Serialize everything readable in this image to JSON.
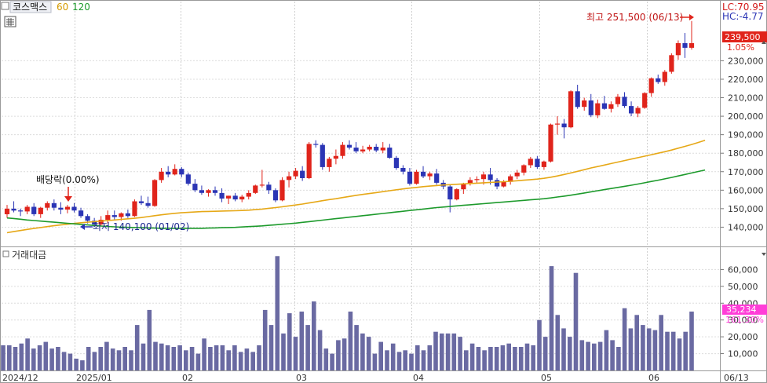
{
  "header": {
    "symbol": "코스맥스",
    "ma_periods": [
      "60",
      "120"
    ],
    "lc_label": "LC:70.95",
    "hc_label": "HC:-4.77"
  },
  "colors": {
    "up": "#e0241b",
    "down": "#2b35b5",
    "ma60": "#e6a817",
    "ma120": "#1d9a2c",
    "volume": "#6a6aa2",
    "price_tag": "#e0241b",
    "volume_tag": "#ff3dd8"
  },
  "price_panel": {
    "current_price": "239,500",
    "current_change": "1.05%",
    "high_annotation": "최고 251,500 (06/13)",
    "low_annotation": "최저 140,100 (01/02)",
    "dividend_annotation": "배당락(0.00%)"
  },
  "volume_panel": {
    "title": "거래대금",
    "current_value": "35,234",
    "current_change": "161.30%"
  },
  "x_axis_labels": [
    "2024/12",
    "2025/01",
    "02",
    "03",
    "04",
    "05",
    "06",
    "06/13"
  ],
  "chart_data": [
    {
      "type": "candlestick",
      "title": "",
      "ylim": [
        130000,
        262000
      ],
      "y_ticks": [
        140000,
        150000,
        160000,
        170000,
        180000,
        190000,
        200000,
        210000,
        220000,
        230000
      ],
      "y_tick_labels": [
        "140,000",
        "150,000",
        "160,000",
        "170,000",
        "180,000",
        "190,000",
        "200,000",
        "210,000",
        "220,000",
        "230,000"
      ],
      "ohlc": [
        [
          147000,
          152000,
          145000,
          150000
        ],
        [
          150000,
          154000,
          148000,
          149000
        ],
        [
          149000,
          150000,
          146000,
          148500
        ],
        [
          148500,
          152000,
          147000,
          151000
        ],
        [
          151000,
          153000,
          146000,
          147000
        ],
        [
          147000,
          151000,
          145000,
          150500
        ],
        [
          150500,
          154000,
          149000,
          153000
        ],
        [
          153000,
          155000,
          149000,
          150500
        ],
        [
          150500,
          153500,
          147000,
          149500
        ],
        [
          149500,
          152000,
          147500,
          151000
        ],
        [
          151000,
          153000,
          148000,
          149000
        ],
        [
          149000,
          150500,
          145000,
          146000
        ],
        [
          146000,
          147000,
          142000,
          143500
        ],
        [
          143500,
          145000,
          140100,
          141500
        ],
        [
          141500,
          146000,
          140800,
          144000
        ],
        [
          144000,
          149000,
          142000,
          146500
        ],
        [
          146500,
          149000,
          144000,
          145500
        ],
        [
          145500,
          148000,
          143500,
          147500
        ],
        [
          147500,
          149500,
          145000,
          146000
        ],
        [
          146000,
          155000,
          145500,
          154000
        ],
        [
          154000,
          157000,
          152000,
          153000
        ],
        [
          153000,
          156500,
          150500,
          151500
        ],
        [
          151500,
          166000,
          151000,
          165500
        ],
        [
          165500,
          172000,
          164000,
          170000
        ],
        [
          170000,
          173000,
          167000,
          168500
        ],
        [
          168500,
          174000,
          168000,
          171500
        ],
        [
          171500,
          172500,
          167000,
          168500
        ],
        [
          168500,
          169500,
          162500,
          163500
        ],
        [
          163500,
          166000,
          159000,
          160000
        ],
        [
          160000,
          162500,
          157500,
          158500
        ],
        [
          158500,
          160500,
          156500,
          160000
        ],
        [
          160000,
          162000,
          157000,
          158500
        ],
        [
          158500,
          161000,
          153500,
          155500
        ],
        [
          155500,
          157000,
          152500,
          157000
        ],
        [
          157000,
          158500,
          154000,
          155000
        ],
        [
          155000,
          157500,
          153500,
          156500
        ],
        [
          156500,
          160000,
          155000,
          158500
        ],
        [
          158500,
          163000,
          158000,
          162500
        ],
        [
          162500,
          171000,
          161500,
          163000
        ],
        [
          163000,
          164500,
          158000,
          160000
        ],
        [
          160000,
          161000,
          153500,
          154500
        ],
        [
          154500,
          167000,
          154000,
          165500
        ],
        [
          165500,
          170000,
          161500,
          167500
        ],
        [
          167500,
          172000,
          166000,
          170500
        ],
        [
          170500,
          173000,
          165000,
          166500
        ],
        [
          166500,
          186000,
          166000,
          185000
        ],
        [
          185000,
          187000,
          183000,
          184500
        ],
        [
          184500,
          185500,
          171000,
          172500
        ],
        [
          172500,
          178000,
          170000,
          177000
        ],
        [
          177000,
          182000,
          174000,
          178500
        ],
        [
          178500,
          186000,
          177000,
          184500
        ],
        [
          184500,
          187000,
          182000,
          183000
        ],
        [
          183000,
          186000,
          180000,
          181000
        ],
        [
          181000,
          184000,
          180000,
          182000
        ],
        [
          182000,
          184500,
          181000,
          183500
        ],
        [
          183500,
          185000,
          180500,
          181500
        ],
        [
          181500,
          186000,
          180000,
          183000
        ],
        [
          183000,
          185000,
          177000,
          177500
        ],
        [
          177500,
          178500,
          171000,
          172000
        ],
        [
          172000,
          173500,
          168500,
          170000
        ],
        [
          170000,
          172000,
          162500,
          163500
        ],
        [
          163500,
          171000,
          163000,
          170000
        ],
        [
          170000,
          173000,
          166500,
          167500
        ],
        [
          167500,
          170000,
          165500,
          169000
        ],
        [
          169000,
          171500,
          163000,
          164000
        ],
        [
          164000,
          165500,
          160500,
          162000
        ],
        [
          162000,
          163000,
          148000,
          155000
        ],
        [
          155000,
          161000,
          154500,
          160500
        ],
        [
          160500,
          164000,
          158000,
          163500
        ],
        [
          163500,
          167000,
          162500,
          165500
        ],
        [
          165500,
          167500,
          164000,
          166000
        ],
        [
          166000,
          170000,
          163000,
          168500
        ],
        [
          168500,
          172000,
          163000,
          165500
        ],
        [
          165500,
          166500,
          160500,
          162000
        ],
        [
          162000,
          165500,
          161500,
          164500
        ],
        [
          164500,
          168500,
          163000,
          167500
        ],
        [
          167500,
          171000,
          166000,
          169500
        ],
        [
          169500,
          174000,
          168000,
          173500
        ],
        [
          173500,
          178000,
          172000,
          177000
        ],
        [
          177000,
          178500,
          171500,
          172500
        ],
        [
          172500,
          176000,
          171000,
          175500
        ],
        [
          175500,
          196000,
          175000,
          195500
        ],
        [
          195500,
          200000,
          190000,
          196000
        ],
        [
          196000,
          198500,
          188000,
          194000
        ],
        [
          194000,
          214000,
          193500,
          213500
        ],
        [
          213500,
          217000,
          204000,
          205000
        ],
        [
          205000,
          210000,
          203000,
          208500
        ],
        [
          208500,
          212000,
          199500,
          200500
        ],
        [
          200500,
          209000,
          199000,
          207000
        ],
        [
          207000,
          211000,
          203500,
          204000
        ],
        [
          204000,
          208000,
          202000,
          206500
        ],
        [
          206500,
          212000,
          205000,
          210500
        ],
        [
          210500,
          213000,
          204500,
          205500
        ],
        [
          205500,
          208000,
          200000,
          201500
        ],
        [
          201500,
          205500,
          199500,
          204500
        ],
        [
          204500,
          213000,
          204000,
          212500
        ],
        [
          212500,
          221000,
          210500,
          220500
        ],
        [
          220500,
          222500,
          217500,
          218500
        ],
        [
          218500,
          225000,
          216500,
          224000
        ],
        [
          224000,
          234000,
          223000,
          233000
        ],
        [
          233000,
          241000,
          230500,
          239500
        ],
        [
          239500,
          245000,
          231500,
          237000
        ],
        [
          237000,
          251500,
          236000,
          239500
        ]
      ],
      "series": [
        {
          "name": "60",
          "values": [
            137000,
            137600,
            138200,
            138800,
            139300,
            139800,
            140300,
            140800,
            141200,
            141600,
            142000,
            142400,
            142700,
            143000,
            143300,
            143600,
            143900,
            144200,
            144500,
            144800,
            145200,
            145700,
            146200,
            146700,
            147100,
            147500,
            147800,
            148000,
            148200,
            148400,
            148500,
            148600,
            148700,
            148800,
            148900,
            149000,
            149200,
            149500,
            149800,
            150200,
            150600,
            151000,
            151500,
            152000,
            152500,
            153100,
            153700,
            154300,
            154900,
            155400,
            156000,
            156600,
            157200,
            157700,
            158200,
            158700,
            159200,
            159700,
            160200,
            160700,
            161100,
            161500,
            161900,
            162200,
            162500,
            162800,
            163000,
            163200,
            163400,
            163600,
            163800,
            164000,
            164200,
            164400,
            164600,
            164800,
            165100,
            165400,
            165700,
            166000,
            166400,
            167000,
            167700,
            168500,
            169300,
            170200,
            171100,
            172000,
            172800,
            173600,
            174400,
            175200,
            176000,
            176800,
            177600,
            178400,
            179200,
            180000,
            180800,
            181700,
            182700,
            183700,
            184700,
            185800,
            187000
          ]
        },
        {
          "name": "120",
          "values": [
            145000,
            144700,
            144300,
            143900,
            143600,
            143300,
            143000,
            142700,
            142400,
            142100,
            141800,
            141500,
            141200,
            140900,
            140600,
            140400,
            140200,
            140000,
            139900,
            139800,
            139700,
            139600,
            139500,
            139400,
            139400,
            139400,
            139400,
            139400,
            139400,
            139400,
            139500,
            139600,
            139700,
            139800,
            139900,
            140100,
            140300,
            140500,
            140700,
            141000,
            141300,
            141600,
            141900,
            142200,
            142600,
            143000,
            143400,
            143800,
            144200,
            144600,
            145000,
            145400,
            145800,
            146200,
            146600,
            147000,
            147400,
            147800,
            148200,
            148600,
            149000,
            149400,
            149800,
            150200,
            150600,
            150900,
            151200,
            151500,
            151800,
            152100,
            152400,
            152700,
            153000,
            153300,
            153600,
            153900,
            154200,
            154500,
            154800,
            155100,
            155400,
            155800,
            156300,
            156800,
            157300,
            157900,
            158500,
            159100,
            159700,
            160300,
            160900,
            161500,
            162100,
            162700,
            163300,
            164000,
            164700,
            165400,
            166100,
            166900,
            167700,
            168500,
            169300,
            170100,
            170900
          ]
        }
      ]
    },
    {
      "type": "bar",
      "title": "",
      "ylim": [
        0,
        70000
      ],
      "y_ticks": [
        10000,
        20000,
        30000,
        40000,
        50000,
        60000
      ],
      "y_tick_labels": [
        "10,000",
        "20,000",
        "30,000",
        "40,000",
        "50,000",
        "60,000"
      ],
      "values": [
        15000,
        15000,
        14000,
        16000,
        19000,
        13000,
        15000,
        17000,
        13000,
        14000,
        11000,
        10000,
        7000,
        6000,
        14000,
        11000,
        14000,
        17000,
        13000,
        12000,
        14000,
        12000,
        27000,
        16000,
        36000,
        17000,
        16000,
        15000,
        14000,
        15000,
        12000,
        14000,
        10000,
        19000,
        14000,
        15000,
        15000,
        12000,
        15000,
        11000,
        13000,
        11000,
        15000,
        36000,
        27000,
        68000,
        22000,
        34000,
        20000,
        35000,
        27000,
        41000,
        24000,
        13000,
        10000,
        18000,
        19000,
        35000,
        27000,
        22000,
        20000,
        10000,
        17000,
        12000,
        16000,
        11000,
        12000,
        10000,
        15000,
        12000,
        15000,
        23000,
        22000,
        22000,
        22000,
        20000,
        12000,
        16000,
        14000,
        12000,
        14000,
        14000,
        15000,
        16000,
        14000,
        14000,
        16000,
        15000,
        30000,
        20000,
        62000,
        33000,
        25000,
        20000,
        58000,
        18000,
        17000,
        16000,
        17000,
        24000,
        18000,
        14000,
        37000,
        25000,
        33000,
        27000,
        25000,
        24000,
        33000,
        23000,
        23000,
        19000,
        23000,
        35000
      ]
    }
  ]
}
